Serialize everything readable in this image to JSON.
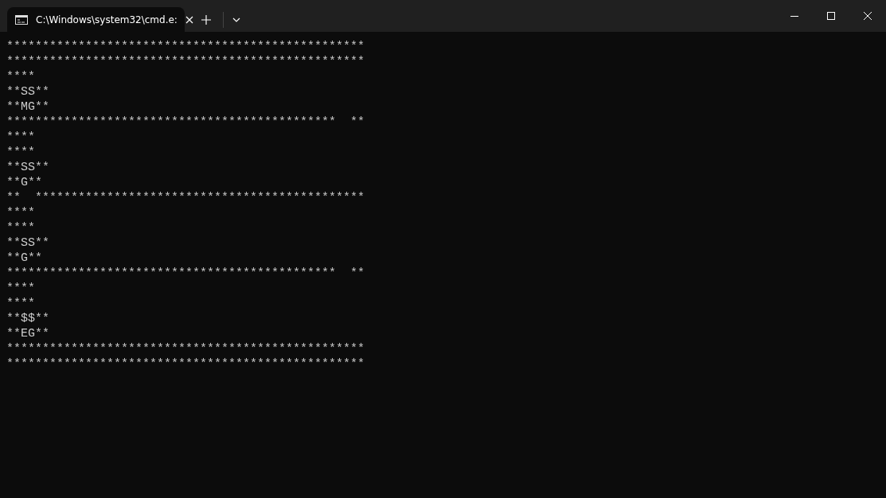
{
  "tab": {
    "title": "C:\\Windows\\system32\\cmd.e:",
    "selected": true
  },
  "terminal": {
    "lines": [
      "**************************************************",
      "**************************************************",
      "****",
      "**SS**",
      "**MG**",
      "**********************************************  **",
      "****",
      "****",
      "**SS**",
      "**G**",
      "**  **********************************************",
      "****",
      "****",
      "**SS**",
      "**G**",
      "**********************************************  **",
      "****",
      "****",
      "**$$**",
      "**EG**",
      "**************************************************",
      "**************************************************"
    ]
  }
}
